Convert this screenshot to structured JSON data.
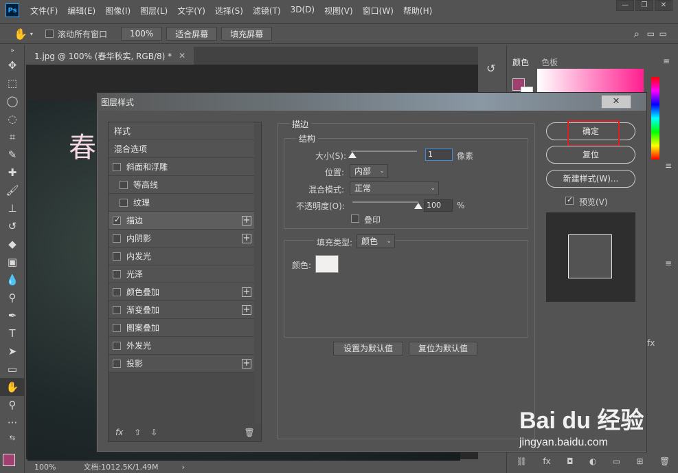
{
  "app": {
    "logo": "Ps"
  },
  "menu": [
    "文件(F)",
    "编辑(E)",
    "图像(I)",
    "图层(L)",
    "文字(Y)",
    "选择(S)",
    "滤镜(T)",
    "3D(D)",
    "视图(V)",
    "窗口(W)",
    "帮助(H)"
  ],
  "options_bar": {
    "scroll_all_label": "滚动所有窗口",
    "zoom_value": "100%",
    "fit_screen_label": "适合屏幕",
    "fill_screen_label": "填充屏幕"
  },
  "document": {
    "tab_title": "1.jpg @ 100% (春华秋实, RGB/8) *",
    "canvas_text": "春",
    "status_zoom": "100%",
    "status_info": "文档:1012.5K/1.49M"
  },
  "right_panel": {
    "color_tab": "颜色",
    "swatches_tab": "色板",
    "foreground_color": "#a0406e",
    "fx_label": "fx"
  },
  "dialog": {
    "title": "图层样式",
    "close_label": "✕",
    "style_list": [
      {
        "label": "样式",
        "type": "header",
        "checkbox": false,
        "checked": false,
        "plus": false,
        "indent": false
      },
      {
        "label": "混合选项",
        "type": "header",
        "checkbox": false,
        "checked": false,
        "plus": false,
        "indent": false
      },
      {
        "label": "斜面和浮雕",
        "type": "item",
        "checkbox": true,
        "checked": false,
        "plus": false,
        "indent": false
      },
      {
        "label": "等高线",
        "type": "item",
        "checkbox": true,
        "checked": false,
        "plus": false,
        "indent": true
      },
      {
        "label": "纹理",
        "type": "item",
        "checkbox": true,
        "checked": false,
        "plus": false,
        "indent": true
      },
      {
        "label": "描边",
        "type": "item",
        "checkbox": true,
        "checked": true,
        "plus": true,
        "indent": false,
        "selected": true
      },
      {
        "label": "内阴影",
        "type": "item",
        "checkbox": true,
        "checked": false,
        "plus": true,
        "indent": false
      },
      {
        "label": "内发光",
        "type": "item",
        "checkbox": true,
        "checked": false,
        "plus": false,
        "indent": false
      },
      {
        "label": "光泽",
        "type": "item",
        "checkbox": true,
        "checked": false,
        "plus": false,
        "indent": false
      },
      {
        "label": "颜色叠加",
        "type": "item",
        "checkbox": true,
        "checked": false,
        "plus": true,
        "indent": false
      },
      {
        "label": "渐变叠加",
        "type": "item",
        "checkbox": true,
        "checked": false,
        "plus": true,
        "indent": false
      },
      {
        "label": "图案叠加",
        "type": "item",
        "checkbox": true,
        "checked": false,
        "plus": false,
        "indent": false
      },
      {
        "label": "外发光",
        "type": "item",
        "checkbox": true,
        "checked": false,
        "plus": false,
        "indent": false
      },
      {
        "label": "投影",
        "type": "item",
        "checkbox": true,
        "checked": false,
        "plus": true,
        "indent": false
      }
    ],
    "list_footer": {
      "fx_label": "fx"
    },
    "stroke": {
      "group_title": "描边",
      "structure_title": "结构",
      "size_label": "大小(S):",
      "size_value": "1",
      "size_unit": "像素",
      "position_label": "位置:",
      "position_value": "内部",
      "blend_label": "混合模式:",
      "blend_value": "正常",
      "opacity_label": "不透明度(O):",
      "opacity_value": "100",
      "opacity_unit": "%",
      "overprint_label": "叠印",
      "fill_type_label": "填充类型:",
      "fill_type_value": "颜色",
      "color_label": "颜色:",
      "stroke_color": "#f2f0ee",
      "set_default_label": "设置为默认值",
      "reset_default_label": "复位为默认值"
    },
    "buttons": {
      "ok_label": "确定",
      "reset_label": "复位",
      "new_style_label": "新建样式(W)...",
      "preview_label": "预览(V)"
    }
  },
  "watermark": {
    "logo_text": "Bai du 经验",
    "url": "jingyan.baidu.com"
  }
}
